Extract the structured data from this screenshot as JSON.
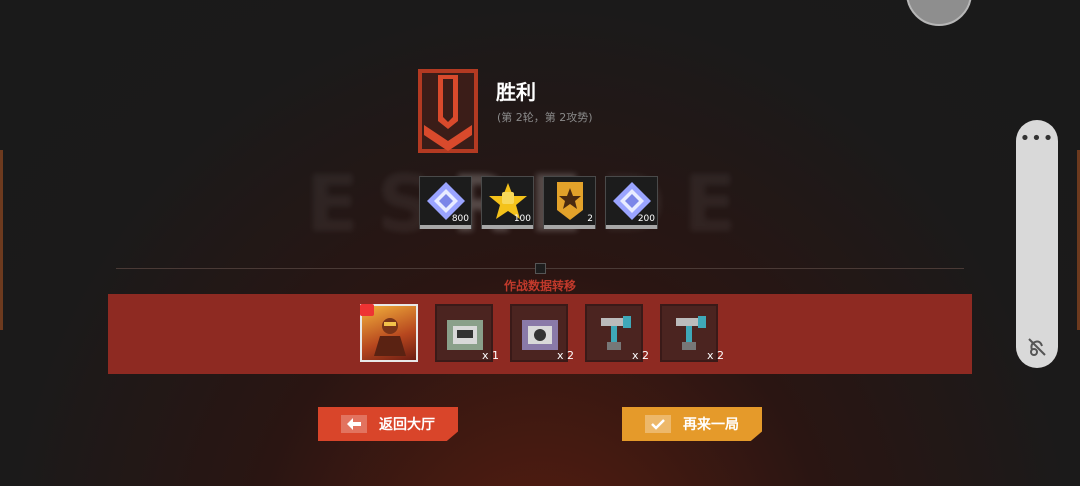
{
  "background_text": {
    "left": "ES",
    "mid": "RE",
    "right": "DE"
  },
  "result": {
    "title": "胜利",
    "subtitle": "(第 2轮，第 2攻势)"
  },
  "rewards": [
    {
      "icon": "crystal-icon",
      "quantity": "800"
    },
    {
      "icon": "fist-star-icon",
      "quantity": "100"
    },
    {
      "icon": "medal-icon",
      "quantity": "2"
    },
    {
      "icon": "crystal-icon",
      "quantity": "200"
    }
  ],
  "transfer_label": "作战数据转移",
  "items": [
    {
      "icon": "hero-portrait-icon",
      "quantity": ""
    },
    {
      "icon": "weapon-crate-icon",
      "quantity": "x 1"
    },
    {
      "icon": "armor-crate-icon",
      "quantity": "x 2"
    },
    {
      "icon": "rocket-launcher-icon",
      "quantity": "x 2"
    },
    {
      "icon": "rocket-launcher-icon",
      "quantity": "x 2"
    }
  ],
  "buttons": {
    "back_label": "返回大厅",
    "again_label": "再来一局"
  },
  "colors": {
    "band": "#8e2a22",
    "back_button": "#d9452a",
    "again_button": "#e59a2a",
    "title": "#ffffff"
  }
}
